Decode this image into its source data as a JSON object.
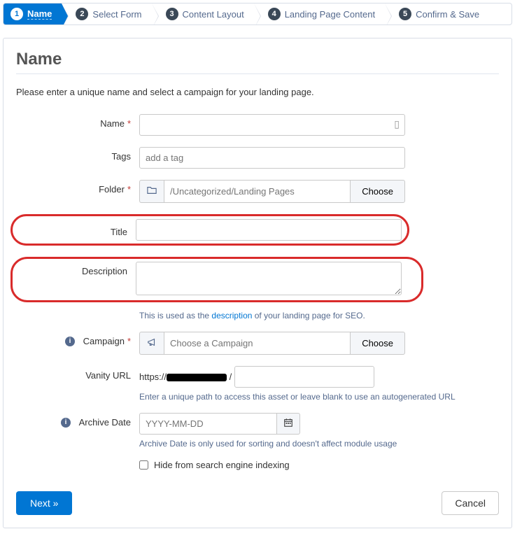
{
  "wizard": {
    "steps": [
      {
        "num": "1",
        "label": "Name"
      },
      {
        "num": "2",
        "label": "Select Form"
      },
      {
        "num": "3",
        "label": "Content Layout"
      },
      {
        "num": "4",
        "label": "Landing Page Content"
      },
      {
        "num": "5",
        "label": "Confirm & Save"
      }
    ]
  },
  "page": {
    "heading": "Name",
    "intro": "Please enter a unique name and select a campaign for your landing page."
  },
  "labels": {
    "name": "Name",
    "tags": "Tags",
    "folder": "Folder",
    "title": "Title",
    "description": "Description",
    "campaign": "Campaign",
    "vanity": "Vanity URL",
    "archive": "Archive Date",
    "hide": "Hide from search engine indexing"
  },
  "placeholders": {
    "tags": "add a tag",
    "folder": "/Uncategorized/Landing Pages",
    "campaign": "Choose a Campaign",
    "archive": "YYYY-MM-DD"
  },
  "buttons": {
    "choose": "Choose",
    "next": "Next »",
    "cancel": "Cancel"
  },
  "help": {
    "desc_pre": "This is used as the ",
    "desc_link": "description",
    "desc_post": " of your landing page for SEO.",
    "vanity": "Enter a unique path to access this asset or leave blank to use an autogenerated URL",
    "archive": "Archive Date is only used for sorting and doesn't affect module usage"
  },
  "vanity": {
    "prefix": "https://",
    "slash": "/"
  }
}
